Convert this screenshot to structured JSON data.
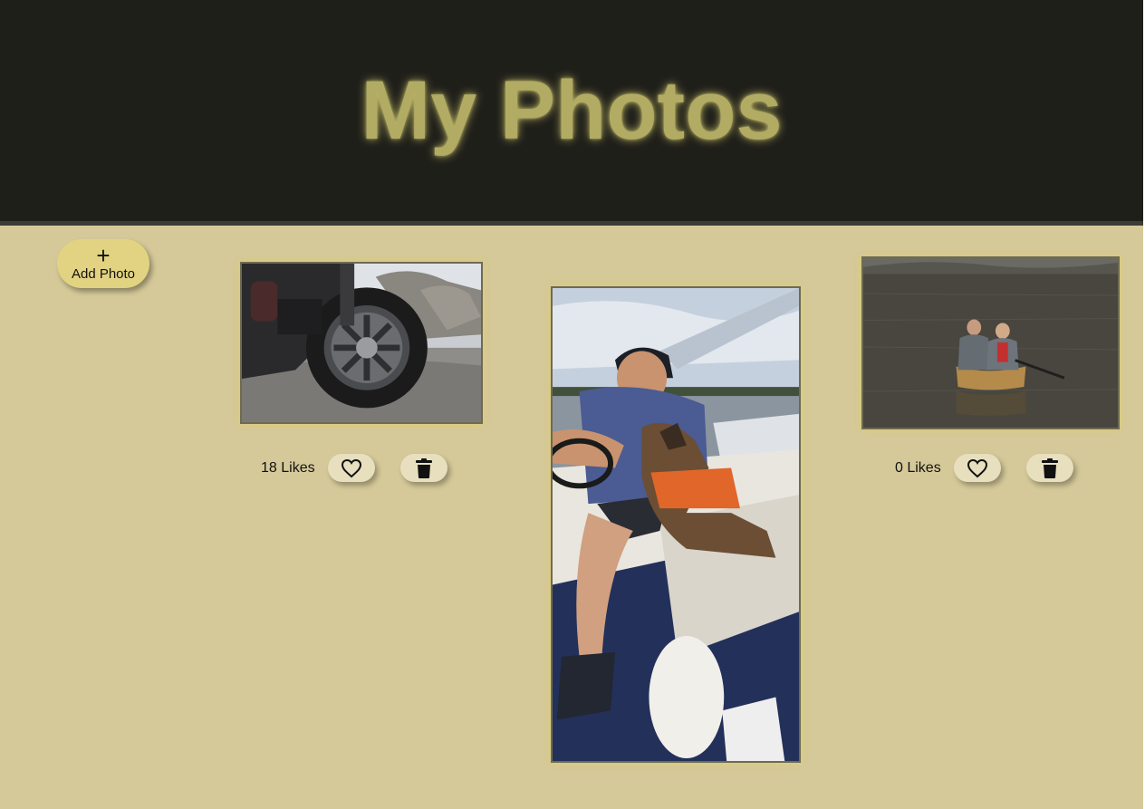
{
  "header": {
    "title": "My Photos"
  },
  "add_photo": {
    "icon": "+",
    "label": "Add Photo"
  },
  "photos": [
    {
      "subject": "motorcycle front wheel",
      "likes_label": "18 Likes",
      "like_icon": "heart-outline-icon",
      "delete_icon": "trash-icon"
    },
    {
      "subject": "man driving boat with dog in life vest"
    },
    {
      "subject": "two people in a canoe on a lake",
      "likes_label": "0 Likes",
      "like_icon": "heart-outline-icon",
      "delete_icon": "trash-icon"
    }
  ],
  "colors": {
    "header_bg": "#1f1f1a",
    "title": "#b2ab63",
    "page_bg": "#d5c999",
    "add_button": "#e1d381",
    "action_button": "#e7dfbe"
  }
}
